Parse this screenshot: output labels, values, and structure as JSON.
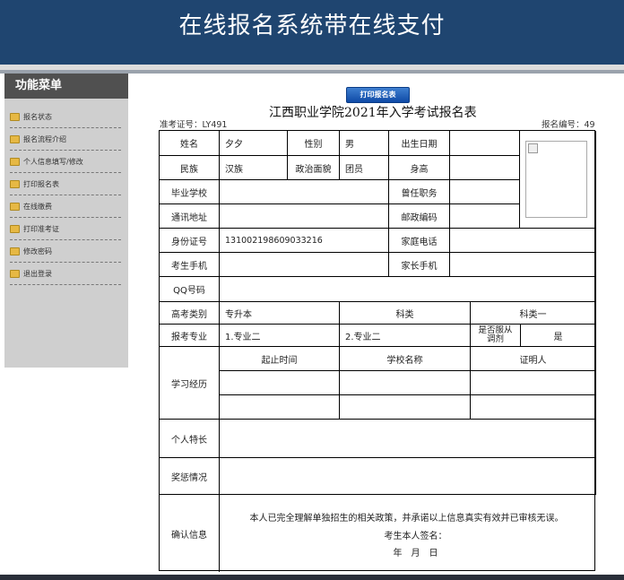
{
  "header": {
    "title": "在线报名系统带在线支付"
  },
  "sidebar": {
    "title": "功能菜单",
    "items": [
      {
        "label": "报名状态"
      },
      {
        "label": "报名流程介绍"
      },
      {
        "label": "个人信息填写/修改"
      },
      {
        "label": "打印报名表"
      },
      {
        "label": "在线缴费"
      },
      {
        "label": "打印准考证"
      },
      {
        "label": "修改密码"
      },
      {
        "label": "退出登录"
      }
    ]
  },
  "form": {
    "print_button": "打印报名表",
    "title": "江西职业学院2021年入学考试报名表",
    "ticket": "准考证号：LY491",
    "reg_no": "报名编号：49",
    "labels": {
      "name": "姓名",
      "gender": "性别",
      "birth": "出生日期",
      "ethnic": "民族",
      "politics": "政治面貌",
      "height": "身高",
      "school": "毕业学校",
      "position": "曾任职务",
      "address": "通讯地址",
      "postcode": "邮政编码",
      "idcard": "身份证号",
      "homephone": "家庭电话",
      "mobile": "考生手机",
      "parentphone": "家长手机",
      "qq": "QQ号码",
      "exam_type": "高考类别",
      "subject": "科类",
      "major": "报考专业",
      "adjust": "是否服从调剂",
      "study": "学习经历",
      "period": "起止时间",
      "school_name": "学校名称",
      "witness": "证明人",
      "specialty": "个人特长",
      "awards": "奖惩情况",
      "confirm": "确认信息"
    },
    "values": {
      "name": "夕夕",
      "gender": "男",
      "birth": "",
      "ethnic": "汉族",
      "politics": "团员",
      "height": "",
      "school": "",
      "position": "",
      "address": "",
      "postcode": "",
      "idcard": "131002198609033216",
      "homephone": "",
      "mobile": "",
      "parentphone": "",
      "qq": "",
      "exam_type": "专升本",
      "subject": "科类一",
      "major1": "1.专业二",
      "major2": "2.专业二",
      "adjust": "是"
    },
    "confirm_text": "本人已完全理解单独招生的相关政策，并承诺以上信息真实有效并已审核无误。",
    "signature": "考生本人签名：",
    "date": "年　月　日"
  }
}
